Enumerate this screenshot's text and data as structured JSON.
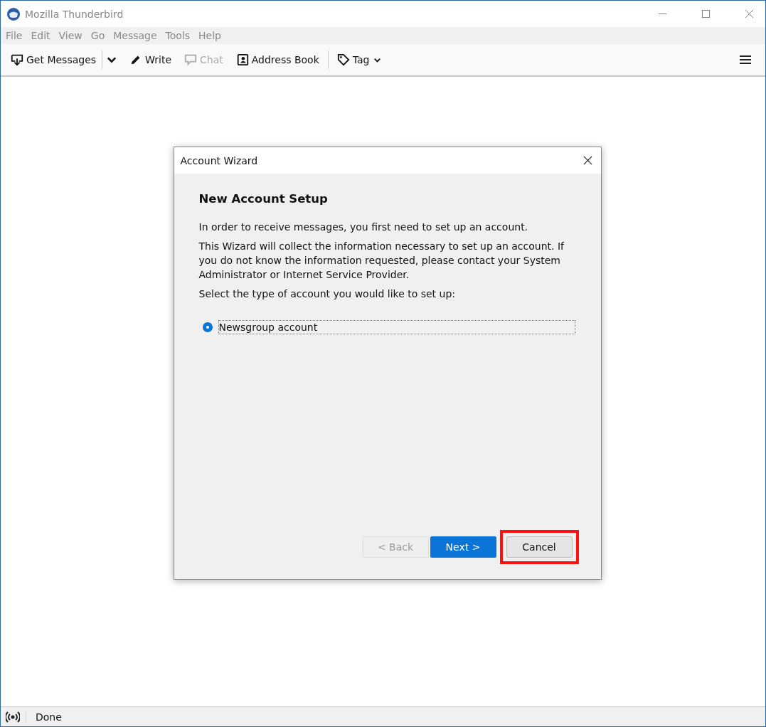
{
  "window": {
    "title": "Mozilla Thunderbird"
  },
  "menu": [
    {
      "label": "File",
      "disabled": true
    },
    {
      "label": "Edit",
      "disabled": true
    },
    {
      "label": "View",
      "disabled": true
    },
    {
      "label": "Go",
      "disabled": true
    },
    {
      "label": "Message",
      "disabled": true
    },
    {
      "label": "Tools",
      "disabled": true
    },
    {
      "label": "Help",
      "disabled": true
    }
  ],
  "toolbar": [
    {
      "kind": "get",
      "label": "Get Messages",
      "disabled": false
    },
    {
      "kind": "dropdown",
      "disabled": false
    },
    {
      "kind": "write",
      "label": "Write",
      "disabled": false
    },
    {
      "kind": "chat",
      "label": "Chat",
      "disabled": true
    },
    {
      "kind": "addressbook",
      "label": "Address Book",
      "disabled": false
    },
    {
      "kind": "tag",
      "label": "Tag",
      "disabled": false
    }
  ],
  "dialog": {
    "title": "Account Wizard",
    "heading": "New Account Setup",
    "paragraphs": [
      "In order to receive messages, you first need to set up an account.",
      "This Wizard will collect the information necessary to set up an account. If you do not know the information requested, please contact your System Administrator or Internet Service Provider.",
      "Select the type of account you would like to set up:"
    ],
    "options": [
      {
        "label": "Newsgroup account",
        "selected": true
      }
    ],
    "buttons": [
      {
        "label": "< Back",
        "disabled": true,
        "primary": false,
        "highlighted": false
      },
      {
        "label": "Next >",
        "disabled": false,
        "primary": true,
        "highlighted": false
      },
      {
        "label": "Cancel",
        "disabled": false,
        "primary": false,
        "highlighted": true
      }
    ]
  },
  "status_bar": {
    "text": "Done"
  }
}
